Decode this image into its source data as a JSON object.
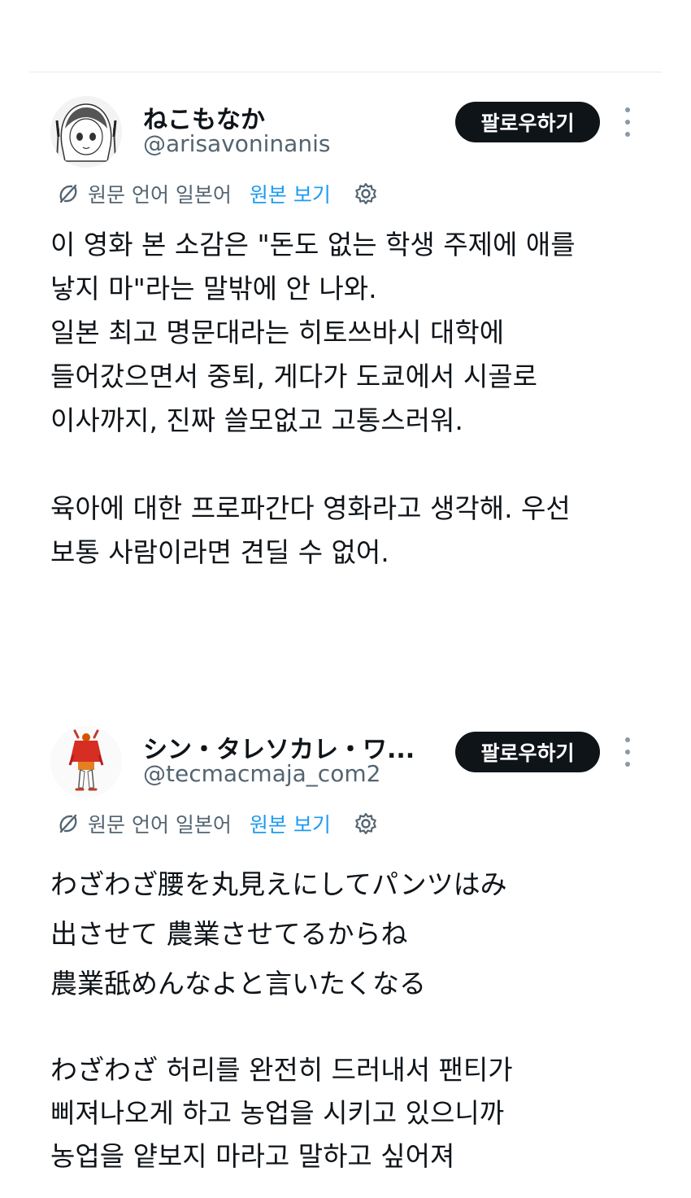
{
  "follow_label": "팔로우하기",
  "translation_bar": {
    "source_language_text": "원문 언어 일본어",
    "view_original_label": "원본 보기"
  },
  "posts": [
    {
      "display_name": "ねこもなか",
      "handle": "@arisavoninanis",
      "avatar_icon": "manga-girl-avatar",
      "body_paragraphs": [
        "이 영화 본 소감은 \"돈도 없는 학생 주제에 애를\n낳지 마\"라는 말밖에 안 나와.\n일본 최고 명문대라는 히토쓰바시 대학에\n들어갔으면서 중퇴, 게다가 도쿄에서 시골로\n이사까지, 진짜 쓸모없고 고통스러워.",
        "육아에 대한 프로파간다 영화라고 생각해. 우선\n보통 사람이라면 견딜 수 없어."
      ]
    },
    {
      "display_name": "シン・タレソカレ・ワ...",
      "handle": "@tecmacmaja_com2",
      "avatar_icon": "red-dress-figure-avatar",
      "body_paragraphs": [
        "わざわざ腰を丸見えにしてパンツはみ\n出させて 農業させてるからね\n農業舐めんなよと言いたくなる",
        "わざわざ 허리를 완전히 드러내서 팬티가\n삐져나오게 하고 농업을 시키고 있으니까\n농업을 얕보지 마라고 말하고 싶어져"
      ]
    }
  ],
  "colors": {
    "text": "#0f1419",
    "secondary_text": "#536471",
    "link": "#1d9bf0",
    "button_bg": "#0f1419",
    "button_text": "#ffffff",
    "divider": "#e6e9ec"
  }
}
